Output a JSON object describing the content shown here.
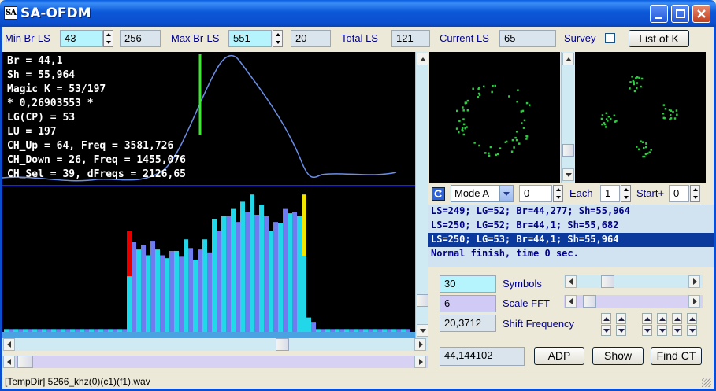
{
  "window": {
    "title": "SA-OFDM",
    "icon_text": "SA"
  },
  "toolbar": {
    "min_br_ls_label": "Min Br-LS",
    "min_br_ls_value": "43",
    "min_br_ls_second": "256",
    "max_br_ls_label": "Max Br-LS",
    "max_br_ls_value": "551",
    "max_br_ls_second": "20",
    "total_ls_label": "Total LS",
    "total_ls_value": "121",
    "current_ls_label": "Current LS",
    "current_ls_value": "65",
    "survey_label": "Survey",
    "list_of_k_label": "List of K"
  },
  "info_lines": [
    "Br = 44,1",
    "Sh = 55,964",
    "Magic K = 53/197",
    "* 0,26903553 *",
    "LG(CP) = 53",
    "LU = 197",
    "CH_Up = 64, Freq = 3581,726",
    "CH_Down = 26, Freq = 1455,076",
    "CH_Sel = 39, dFreqs = 2126,65"
  ],
  "mode_row": {
    "mode_value": "Mode A",
    "offset_value": "0",
    "each_label": "Each",
    "each_value": "1",
    "start_label": "Start+",
    "start_value": "0"
  },
  "log": {
    "lines": [
      "LS=249; LG=52; Br=44,277; Sh=55,964",
      "LS=250; LG=52; Br=44,1; Sh=55,682",
      "LS=250; LG=53; Br=44,1; Sh=55,964",
      "Normal finish, time 0 sec."
    ],
    "selected_index": 2
  },
  "controls": {
    "symbols_value": "30",
    "symbols_label": "Symbols",
    "scale_fft_value": "6",
    "scale_fft_label": "Scale FFT",
    "shift_freq_value": "20,3712",
    "shift_freq_label": "Shift Frequency",
    "readout_value": "44,144102",
    "adp_label": "ADP",
    "show_label": "Show",
    "find_ct_label": "Find CT"
  },
  "statusbar": {
    "text": "[TempDir] 5266_khz(0)(c1)(f1).wav"
  },
  "colors": {
    "accent": "#0b4fce",
    "constellation": "#2ecc40",
    "bar_cyan": "#22d8e8",
    "bar_blue": "#6f7cf0",
    "curve": "#6b8fe8",
    "marker_red": "#e00000",
    "marker_yellow": "#f2e600"
  },
  "spectrum": {
    "bars": [
      0.02,
      0.02,
      0.02,
      0.02,
      0.02,
      0.02,
      0.02,
      0.02,
      0.02,
      0.02,
      0.02,
      0.02,
      0.02,
      0.02,
      0.02,
      0.02,
      0.02,
      0.02,
      0.02,
      0.02,
      0.02,
      0.02,
      0.02,
      0.02,
      0.02,
      0.02,
      0.7,
      0.62,
      0.57,
      0.6,
      0.53,
      0.63,
      0.57,
      0.53,
      0.51,
      0.56,
      0.56,
      0.52,
      0.64,
      0.58,
      0.5,
      0.57,
      0.64,
      0.55,
      0.78,
      0.7,
      0.8,
      0.8,
      0.85,
      0.76,
      0.9,
      0.83,
      0.95,
      0.81,
      0.88,
      0.8,
      0.7,
      0.76,
      0.75,
      0.85,
      0.82,
      0.83,
      0.8,
      0.95,
      0.1,
      0.07,
      0.02,
      0.02,
      0.02,
      0.02,
      0.02,
      0.02,
      0.02,
      0.02,
      0.02,
      0.02,
      0.02,
      0.02,
      0.02,
      0.02,
      0.02,
      0.02,
      0.02,
      0.02,
      0.02,
      0.02
    ],
    "marker_red_index": 26,
    "marker_yellow_index": 63
  }
}
